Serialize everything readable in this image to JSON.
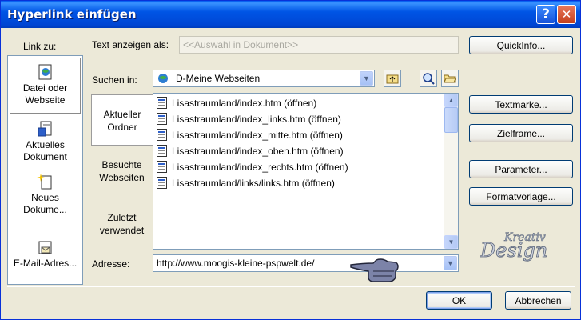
{
  "window": {
    "title": "Hyperlink einfügen"
  },
  "titlebar": {
    "help_symbol": "?",
    "close_symbol": "✕"
  },
  "labels": {
    "link_to": "Link zu:",
    "display_text": "Text anzeigen als:",
    "look_in": "Suchen in:",
    "address": "Adresse:"
  },
  "display_text": {
    "value": "<<Auswahl in Dokument>>"
  },
  "look_in": {
    "value": "D-Meine Webseiten"
  },
  "places": [
    {
      "label_line1": "Datei oder",
      "label_line2": "Webseite",
      "selected": true,
      "icon": "web-page-icon"
    },
    {
      "label_line1": "Aktuelles",
      "label_line2": "Dokument",
      "selected": false,
      "icon": "current-document-icon"
    },
    {
      "label_line1": "Neues",
      "label_line2": "Dokume...",
      "selected": false,
      "icon": "new-document-icon"
    },
    {
      "label_line1": "E-Mail-Adres...",
      "label_line2": "",
      "selected": false,
      "icon": "email-icon"
    }
  ],
  "tabs": [
    {
      "line1": "Aktueller",
      "line2": "Ordner",
      "selected": true
    },
    {
      "line1": "Besuchte",
      "line2": "Webseiten",
      "selected": false
    },
    {
      "line1": "Zuletzt",
      "line2": "verwendet",
      "selected": false
    }
  ],
  "files": [
    "Lisastraumland/index.htm (öffnen)",
    "Lisastraumland/index_links.htm (öffnen)",
    "Lisastraumland/index_mitte.htm (öffnen)",
    "Lisastraumland/index_oben.htm (öffnen)",
    "Lisastraumland/index_rechts.htm (öffnen)",
    "Lisastraumland/links/links.htm (öffnen)"
  ],
  "address": {
    "value": "http://www.moogis-kleine-pspwelt.de/"
  },
  "side_buttons": {
    "quickinfo": "QuickInfo...",
    "bookmark": "Textmarke...",
    "target_frame": "Zielframe...",
    "parameters": "Parameter...",
    "style": "Formatvorlage..."
  },
  "footer": {
    "ok": "OK",
    "cancel": "Abbrechen"
  },
  "watermark": {
    "line1": "Kreativ",
    "line2": "Design"
  },
  "colors": {
    "titlebar": "#0058ee",
    "dialog_bg": "#ece9d8",
    "field_border": "#7f9db9"
  }
}
